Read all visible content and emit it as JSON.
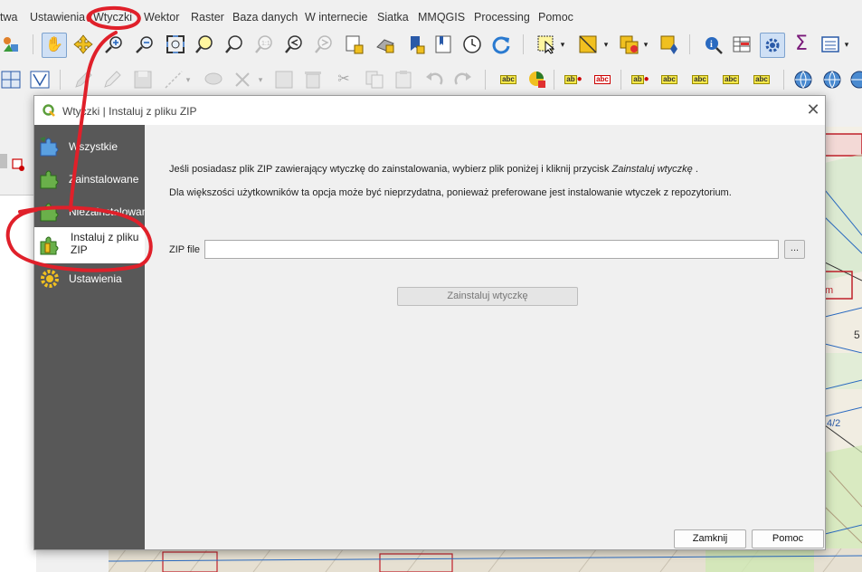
{
  "menubar": {
    "items": [
      "twa",
      "Ustawienia",
      "Wtyczki",
      "Wektor",
      "Raster",
      "Baza danych",
      "W internecie",
      "Siatka",
      "MMQGIS",
      "Processing",
      "Pomoc"
    ]
  },
  "dialog": {
    "title": "Wtyczki | Instaluj z pliku ZIP",
    "sidebar": [
      {
        "label": "Wszystkie"
      },
      {
        "label": "Zainstalowane"
      },
      {
        "label": "Niezainstalowane"
      },
      {
        "label": "Instaluj z pliku ZIP"
      },
      {
        "label": "Ustawienia"
      }
    ],
    "info_line1_prefix": "Jeśli posiadasz plik ZIP zawierający wtyczkę do zainstalowania, wybierz plik poniżej i kliknij przycisk",
    "info_line1_emph": "Zainstaluj wtyczkę",
    "info_line1_suffix": ".",
    "info_line2": "Dla większości użytkowników ta opcja może być nieprzydatna, ponieważ preferowane jest instalowanie wtyczek z repozytorium.",
    "zip_label": "ZIP file",
    "zip_value": "",
    "browse_label": "...",
    "install_label": "Zainstaluj wtyczkę",
    "close_label": "Zamknij",
    "help_label": "Pomoc"
  },
  "toolbar_icons": [
    "pan-hand-icon",
    "zoom-in-icon",
    "zoom-out-icon",
    "refresh-icon",
    "identify-icon",
    "sum-icon",
    "gear-icon",
    "labels-abc-icon"
  ],
  "map_labels": [
    "m",
    "5",
    "4/2"
  ],
  "colors": {
    "sidebar_bg": "#585858",
    "annotation": "#e0202a",
    "map_parcel": "#c0202a"
  }
}
